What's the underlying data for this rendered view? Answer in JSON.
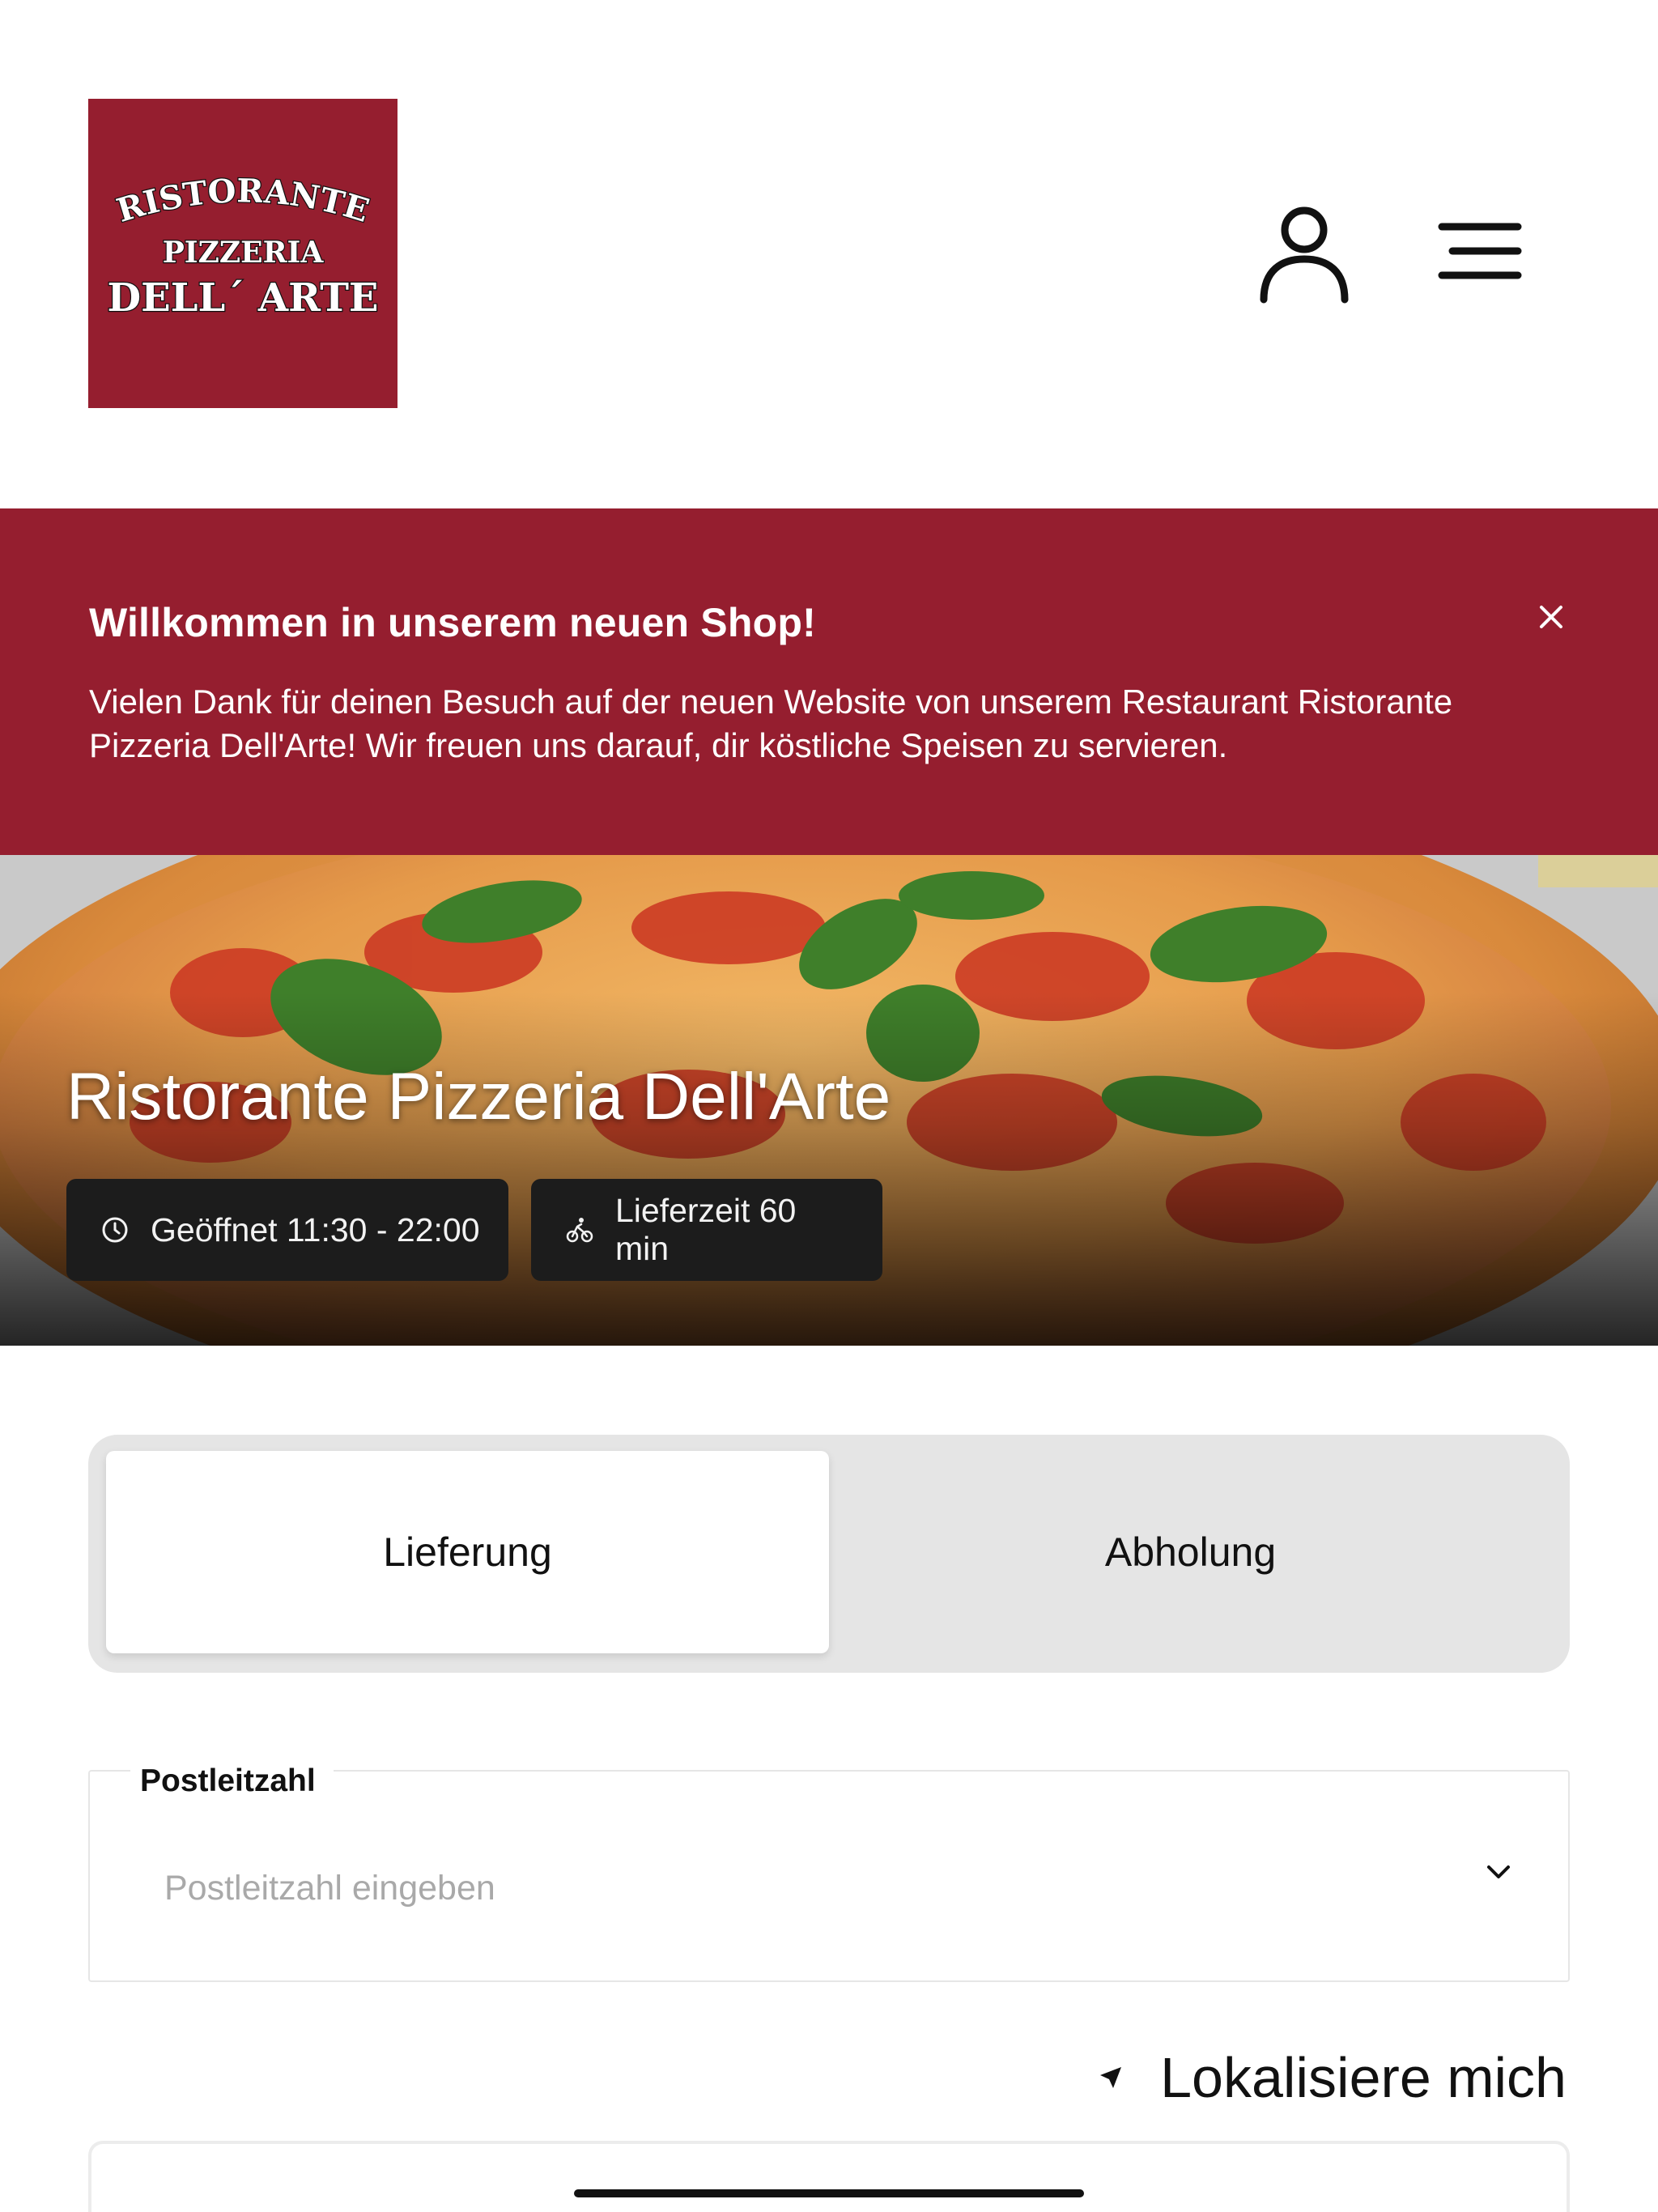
{
  "header": {
    "logo": {
      "line1": "RISTORANTE",
      "line2": "PIZZERIA",
      "line3": "DELL´ ARTE",
      "background_color": "#951e2f"
    },
    "account_icon": "user-icon",
    "menu_icon": "hamburger-menu-icon"
  },
  "banner": {
    "title": "Willkommen in unserem neuen Shop!",
    "text": "Vielen Dank für deinen Besuch auf der neuen Website von unserem Restaurant Ristorante Pizzeria Dell'Arte! Wir freuen uns darauf, dir köstliche Speisen zu servieren.",
    "close_icon": "close-icon",
    "background_color": "#951e2f"
  },
  "hero": {
    "title": "Ristorante Pizzeria Dell'Arte",
    "opening_hours": "Geöffnet 11:30 - 22:00",
    "delivery_time": "Lieferzeit 60 min",
    "opening_icon": "clock-icon",
    "delivery_icon": "bicycle-icon"
  },
  "order_mode": {
    "options": [
      "Lieferung",
      "Abholung"
    ],
    "selected": "Lieferung"
  },
  "postal_code": {
    "label": "Postleitzahl",
    "placeholder": "Postleitzahl eingeben",
    "value": "",
    "dropdown_icon": "chevron-down-icon"
  },
  "locate": {
    "label": "Lokalisiere mich",
    "icon": "location-arrow-icon"
  }
}
